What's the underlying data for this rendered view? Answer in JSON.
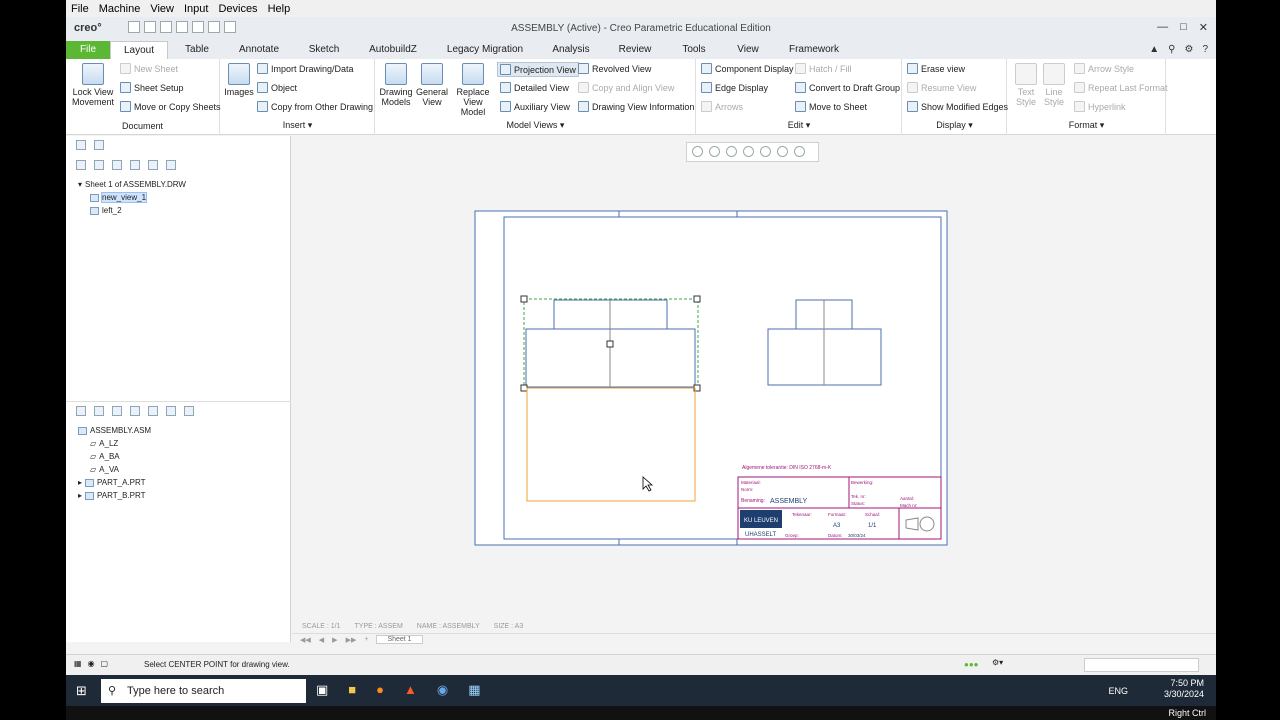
{
  "vm_menu": [
    "File",
    "Machine",
    "View",
    "Input",
    "Devices",
    "Help"
  ],
  "app": {
    "logo": "creo°",
    "title": "ASSEMBLY (Active) - Creo Parametric Educational Edition"
  },
  "tabs": [
    "File",
    "Layout",
    "Table",
    "Annotate",
    "Sketch",
    "AutobuildZ",
    "Legacy Migration",
    "Analysis",
    "Review",
    "Tools",
    "View",
    "Framework"
  ],
  "ribbon": {
    "document": {
      "label": "Document",
      "lock": "Lock View Movement",
      "new_sheet": "New Sheet",
      "sheet_setup": "Sheet Setup",
      "move_copy": "Move or Copy Sheets"
    },
    "insert": {
      "label": "Insert",
      "images": "Images",
      "import": "Import Drawing/Data",
      "object": "Object",
      "copy_other": "Copy from Other Drawing"
    },
    "model_views": {
      "label": "Model Views",
      "drawing_models": "Drawing Models",
      "general_view": "General View",
      "replace_model": "Replace View Model",
      "projection": "Projection View",
      "detailed": "Detailed View",
      "auxiliary": "Auxiliary View",
      "revolved": "Revolved View",
      "copy_align": "Copy and Align View",
      "drawing_info": "Drawing View Information"
    },
    "edit": {
      "label": "Edit",
      "component_display": "Component Display",
      "edge_display": "Edge Display",
      "arrows": "Arrows",
      "hatch": "Hatch / Fill",
      "convert_draft": "Convert to Draft Group",
      "move_sheet": "Move to Sheet"
    },
    "display": {
      "label": "Display",
      "erase": "Erase view",
      "resume": "Resume View",
      "show_modified": "Show Modified Edges"
    },
    "format": {
      "label": "Format",
      "text_style": "Text Style",
      "line_style": "Line Style",
      "arrow_style": "Arrow Style",
      "repeat_last": "Repeat Last Format",
      "hyperlink": "Hyperlink"
    }
  },
  "drawing_tree": {
    "sheet": "Sheet 1 of ASSEMBLY.DRW",
    "views": [
      "new_view_1",
      "left_2"
    ]
  },
  "model_tree": {
    "root": "ASSEMBLY.ASM",
    "items": [
      "A_LZ",
      "A_BA",
      "A_VA",
      "PART_A.PRT",
      "PART_B.PRT"
    ]
  },
  "title_block": {
    "header": "Algemene tolerantie: DIN ISO 2768-m-K",
    "benaming_label": "Benaming:",
    "benaming": "ASSEMBLY",
    "formaat_label": "Formaat:",
    "formaat": "A3",
    "schaal_label": "Schaal:",
    "schaal": "1/1",
    "tekenaar_label": "Tekenaar:",
    "datum_label": "Datum:",
    "datum": "30/03/24",
    "groep_label": "Groep:",
    "logo1": "KU LEUVEN",
    "logo2": "UHASSELT",
    "materiaal": "Materiaal:",
    "norm": "Norm:",
    "bewerking": "Bewerking:",
    "tekenaar2": "Tek. nr:",
    "status": "Status:",
    "aantal": "Aantal:",
    "machine": "Mach nr:"
  },
  "sheet_info": {
    "scale": "SCALE : 1/1",
    "type": "TYPE : ASSEM",
    "name": "NAME : ASSEMBLY",
    "size": "SIZE : A3",
    "tab": "Sheet 1"
  },
  "status": {
    "message": "Select CENTER POINT for drawing view."
  },
  "taskbar": {
    "search": "Type here to search",
    "lang": "ENG",
    "time": "7:50 PM",
    "date": "3/30/2024"
  },
  "vm_status": "Right Ctrl",
  "colors": {
    "file_tab": "#5cb834",
    "selection": "#3da844",
    "title_block": "#a0167a",
    "orange": "#f0a030"
  }
}
